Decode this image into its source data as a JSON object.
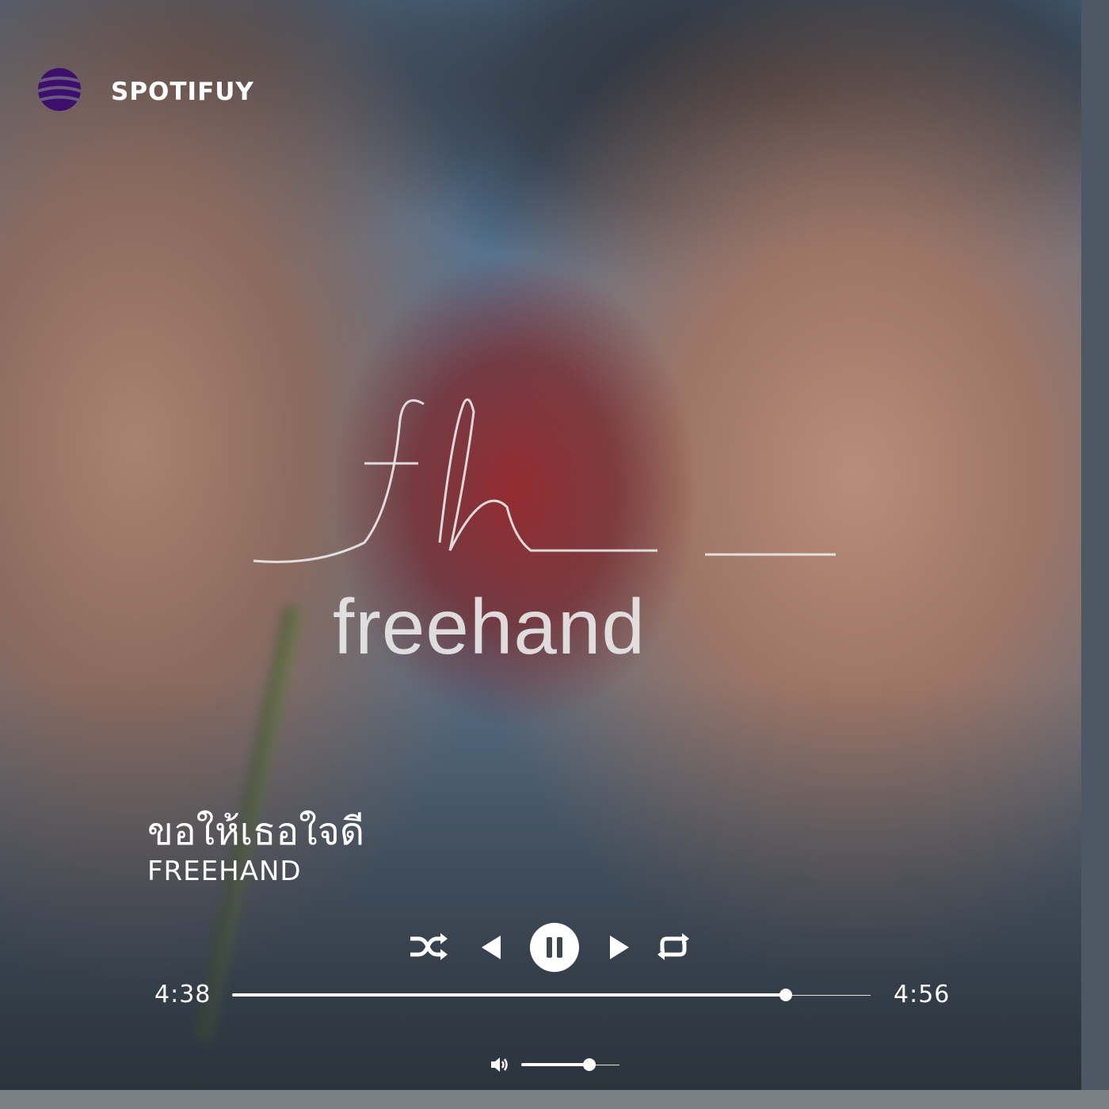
{
  "app": {
    "title": "SPOTIFUY",
    "logo_icon": "striped-circle-logo-icon",
    "logo_color": "#3b0f6b"
  },
  "cover": {
    "brand_script": "fh",
    "brand_word": "freehand"
  },
  "track": {
    "title": "ขอให้เธอใจดี",
    "artist": "FREEHAND"
  },
  "controls": {
    "shuffle_icon": "shuffle-icon",
    "previous_icon": "previous-icon",
    "play_state": "playing",
    "pause_icon": "pause-icon",
    "next_icon": "next-icon",
    "repeat_icon": "repeat-icon"
  },
  "progress": {
    "current_time": "4:38",
    "total_time": "4:56",
    "fraction": 0.867
  },
  "volume": {
    "icon": "volume-icon",
    "level": 0.69
  },
  "colors": {
    "accent": "#ffffff",
    "logo": "#3b0f6b"
  }
}
